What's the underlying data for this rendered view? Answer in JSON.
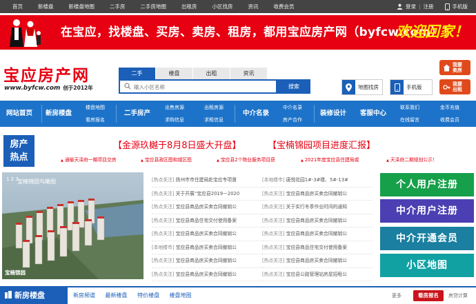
{
  "topbar": {
    "nav": [
      "首页",
      "新楼盘",
      "新楼盘地图",
      "二手房",
      "二手房地图",
      "出租房",
      "小区找房",
      "资讯",
      "收费会员"
    ],
    "login": "登录",
    "sep": "|",
    "register": "注册",
    "mobile": "手机版"
  },
  "banner": {
    "text": "在宝应，找楼盘、买房、卖房、租房，都用宝应房产网（byfcw.com）！",
    "welcome": "欢迎回家！"
  },
  "header": {
    "logo": "宝应房产网",
    "url": "www.byfcw.com",
    "since": "创于2012年",
    "search_tabs": [
      "二手",
      "楼盘",
      "出租",
      "资讯"
    ],
    "search_placeholder": "输入小区名称",
    "search_button": "搜索",
    "map_search": "地图找房",
    "mobile_version": "手机版",
    "sell": [
      "我要",
      "卖房"
    ],
    "rent": [
      "我要",
      "出租"
    ]
  },
  "mainnav": {
    "home": "网站首页",
    "new_homes": "新房楼盘",
    "new_sub": [
      "楼盘地图",
      "看房报名"
    ],
    "second_hand": "二手房产",
    "second_sub": [
      "出售房源",
      "求购信息"
    ],
    "rent_sub": [
      "出租房源",
      "求租信息"
    ],
    "agents": "中介名录",
    "agents_sub": [
      "中介名录",
      "房产合作"
    ],
    "decor": "装修设计",
    "service": "客服中心",
    "service_sub": [
      "联系我们",
      "在线留言"
    ],
    "fees_sub": [
      "金币充值",
      "收费会员"
    ]
  },
  "hot": {
    "label": [
      "房产",
      "热点"
    ],
    "head1": "【金源玖樾于8月8日盛大开盘】",
    "head2": "【宝楠锦园项目进度汇报】",
    "links": [
      "通榆天泽府一期项目交房",
      "宝应县政区图和城区图",
      "宝应县2个物业服务项目获",
      "2021年度宝应县住建局或",
      "天泽府二期规划公示！"
    ]
  },
  "photo": {
    "caption": "宝楠锦园鸟瞰图",
    "nums": "1 2 3",
    "bottom": "宝楠锦园"
  },
  "news_left": [
    {
      "tag": "[热点关注]",
      "text": "扬州市市住建局赴宝应专项督"
    },
    {
      "tag": "[热点关注]",
      "text": "关于开展“宝应县2019—2020"
    },
    {
      "tag": "[热点关注]",
      "text": "宝应县商品房买卖合同撤销公"
    },
    {
      "tag": "[热点关注]",
      "text": "宝应县商品住宅交付使用备案"
    },
    {
      "tag": "[热点关注]",
      "text": "宝应县商品房买卖合同撤销公"
    },
    {
      "tag": "[本地楼市]",
      "text": "宝应县商品房买卖合同撤销公"
    },
    {
      "tag": "[热点关注]",
      "text": "宝应县商品房买卖合同撤销公"
    },
    {
      "tag": "[热点关注]",
      "text": "宝应县商品房买卖合同撤销公"
    }
  ],
  "news_right": [
    {
      "tag": "[本地楼市]",
      "text": "唐悦花园1#-3#楼、5#-13#"
    },
    {
      "tag": "[热点关注]",
      "text": "宝应县商品房买卖合同撤销公"
    },
    {
      "tag": "[热点关注]",
      "text": "关于实行冬季作业时间的通知"
    },
    {
      "tag": "[热点关注]",
      "text": "宝应县商品房买卖合同撤销公"
    },
    {
      "tag": "[热点关注]",
      "text": "宝应县商品房买卖合同撤销公"
    },
    {
      "tag": "[热点关注]",
      "text": "宝应县商品住宅交付使用备案"
    },
    {
      "tag": "[热点关注]",
      "text": "宝应县商品房买卖合同撤销公"
    },
    {
      "tag": "[热点关注]",
      "text": "宝应县公路管理站房屋招租公"
    }
  ],
  "side_buttons": [
    "个人用户注册",
    "中介用户注册",
    "中介开通会员",
    "小区地图"
  ],
  "newbar": {
    "title": "新房楼盘",
    "links": [
      "新房频道",
      "最新楼盘",
      "特价楼盘",
      "楼盘地图"
    ],
    "more": "更多",
    "see_house": "看房报名",
    "calc": "房贷计算"
  },
  "colors": {
    "brand_blue": "#1b5fb8",
    "nav_blue": "#1d73c9",
    "red": "#e60012",
    "green": "#16a04a",
    "purple": "#4b3fb3",
    "teal": "#1a7fa0",
    "cyan": "#12a1a3"
  }
}
